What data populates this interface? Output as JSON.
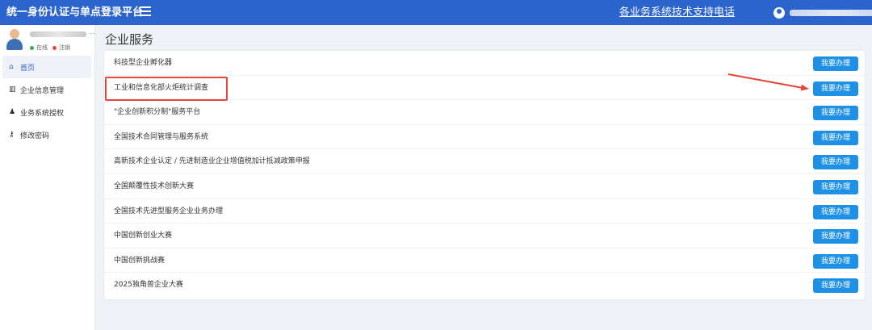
{
  "header": {
    "title": "统一身份认证与单点登录平台",
    "support_link": "各业务系统技术支持电话"
  },
  "sidebar": {
    "status_online": "在线",
    "status_logout": "注销",
    "items": [
      {
        "icon": "home-icon",
        "label": "首页",
        "active": true
      },
      {
        "icon": "bank-icon",
        "label": "企业信息管理"
      },
      {
        "icon": "users-icon",
        "label": "业务系统授权"
      },
      {
        "icon": "key-icon",
        "label": "修改密码"
      }
    ]
  },
  "main": {
    "title": "企业服务",
    "button_label": "我要办理",
    "services": [
      "科技型企业孵化器",
      "工业和信息化部火炬统计调查",
      "\"企业创新积分制\"服务平台",
      "全国技术合同管理与服务系统",
      "高新技术企业认定 / 先进制造业企业增值税加计抵减政策申报",
      "全国颠覆性技术创新大赛",
      "全国技术先进型服务企业业务办理",
      "中国创新创业大赛",
      "中国创新挑战赛",
      "2025独角兽企业大赛"
    ]
  },
  "annotation": {
    "highlight_color": "#e2473a",
    "highlighted_service_index": 1
  }
}
